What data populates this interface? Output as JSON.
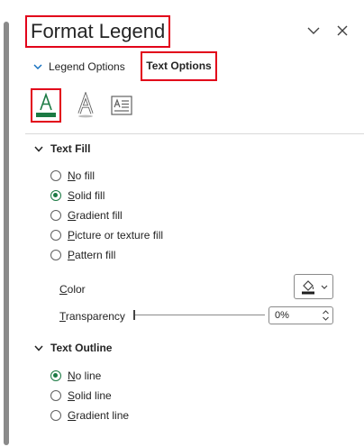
{
  "pane": {
    "title": "Format Legend"
  },
  "tabs": {
    "legend_options": "Legend Options",
    "text_options": "Text Options"
  },
  "icon_tabs": [
    {
      "name": "text-fill-outline-icon",
      "selected": true
    },
    {
      "name": "text-effects-icon",
      "selected": false
    },
    {
      "name": "textbox-icon",
      "selected": false
    }
  ],
  "text_fill": {
    "header": "Text Fill",
    "options": [
      {
        "label": "No fill",
        "accel": "N",
        "rest": "o fill",
        "selected": false
      },
      {
        "label": "Solid fill",
        "accel": "S",
        "rest": "olid fill",
        "selected": true
      },
      {
        "label": "Gradient fill",
        "accel": "G",
        "rest": "radient fill",
        "selected": false
      },
      {
        "label": "Picture or texture fill",
        "accel": "P",
        "rest": "icture or texture fill",
        "selected": false
      },
      {
        "label": "Pattern fill",
        "accel": "P",
        "rest": "attern fill",
        "selected": false
      }
    ],
    "color_label": "Color",
    "color_accel": "C",
    "color_rest": "olor",
    "transparency_label": "Transparency",
    "transparency_accel": "T",
    "transparency_rest": "ransparency",
    "transparency_value": "0%"
  },
  "text_outline": {
    "header": "Text Outline",
    "options": [
      {
        "label": "No line",
        "accel": "N",
        "rest": "o line",
        "selected": true
      },
      {
        "label": "Solid line",
        "accel": "S",
        "rest": "olid line",
        "selected": false
      },
      {
        "label": "Gradient line",
        "accel": "G",
        "rest": "radient line",
        "selected": false
      }
    ]
  },
  "colors": {
    "accent_green": "#1b7a43",
    "highlight_red": "#e2001a",
    "swatch_dark": "#1f1f1f"
  }
}
